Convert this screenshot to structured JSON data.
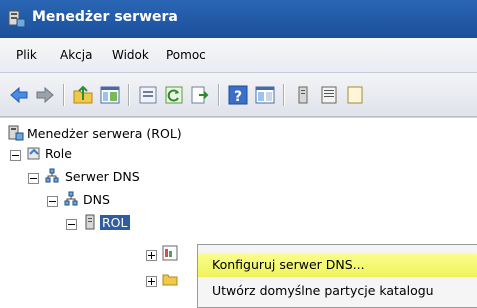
{
  "window": {
    "title": "Menedżer serwera"
  },
  "menu": [
    "Plik",
    "Akcja",
    "Widok",
    "Pomoc"
  ],
  "tree": {
    "root": "Menedżer serwera (ROL)",
    "role": "Role",
    "dns_server": "Serwer DNS",
    "dns": "DNS",
    "rol": "ROL"
  },
  "context_menu": {
    "items": [
      "Konfiguruj serwer DNS...",
      "Utwórz domyślne partycje katalogu"
    ]
  },
  "colors": {
    "titlebar": "#1b4f9a",
    "selection": "#2f5da5",
    "highlight": "#f2f56a"
  },
  "icons": [
    "back-arrow-icon",
    "forward-arrow-icon",
    "up-folder-icon",
    "show-hide-tree-icon",
    "properties-icon",
    "refresh-icon",
    "export-icon",
    "help-icon",
    "console-tree-icon"
  ]
}
